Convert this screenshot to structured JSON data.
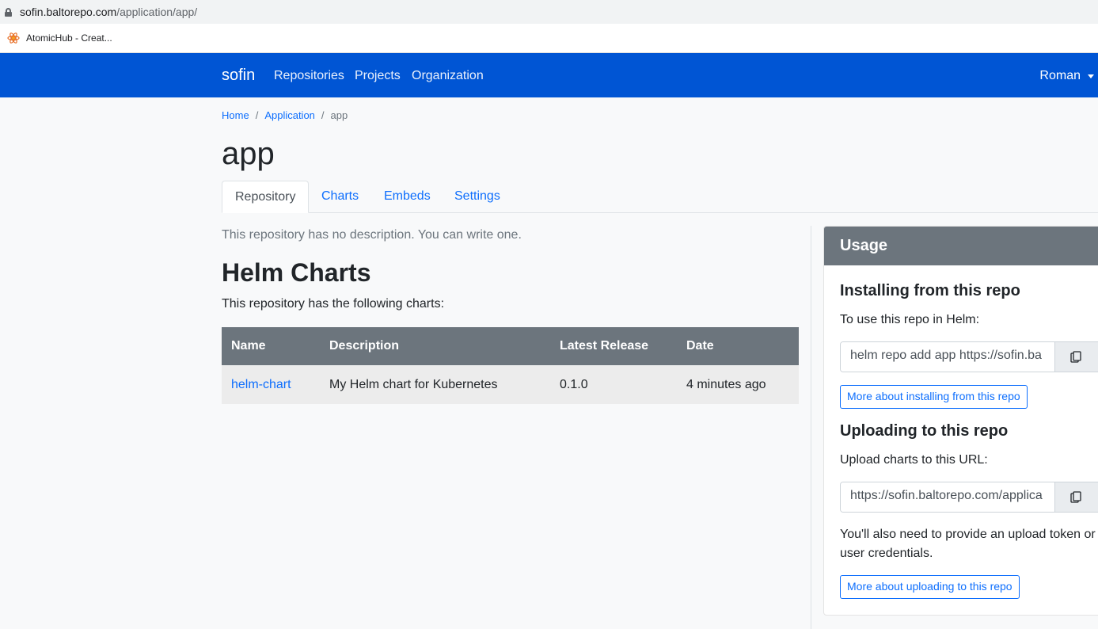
{
  "browser": {
    "url_host": "sofin.baltorepo.com",
    "url_path": "/application/app/",
    "bookmark": "AtomicHub - Creat..."
  },
  "nav": {
    "brand": "sofin",
    "links": [
      "Repositories",
      "Projects",
      "Organization"
    ],
    "user": "Roman"
  },
  "breadcrumb": {
    "home": "Home",
    "application": "Application",
    "current": "app",
    "separator": "/"
  },
  "page": {
    "title": "app",
    "tabs": [
      "Repository",
      "Charts",
      "Embeds",
      "Settings"
    ],
    "active_tab": "Repository",
    "description": "This repository has no description. You can write one.",
    "section_title": "Helm Charts",
    "section_subtitle": "This repository has the following charts:"
  },
  "table": {
    "headers": [
      "Name",
      "Description",
      "Latest Release",
      "Date"
    ],
    "rows": [
      {
        "name": "helm-chart",
        "description": "My Helm chart for Kubernetes",
        "release": "0.1.0",
        "date": "4 minutes ago"
      }
    ]
  },
  "usage": {
    "header": "Usage",
    "install_title": "Installing from this repo",
    "install_text": "To use this repo in Helm:",
    "install_command": "helm repo add app https://sofin.ba",
    "install_button": "More about installing from this repo",
    "upload_title": "Uploading to this repo",
    "upload_text": "Upload charts to this URL:",
    "upload_url": "https://sofin.baltorepo.com/applica",
    "upload_note": "You'll also need to provide an upload token or user credentials.",
    "upload_button": "More about uploading to this repo"
  },
  "colors": {
    "navbar": "#0055d4",
    "link": "#0d6efd",
    "table_header": "#6c757d"
  }
}
